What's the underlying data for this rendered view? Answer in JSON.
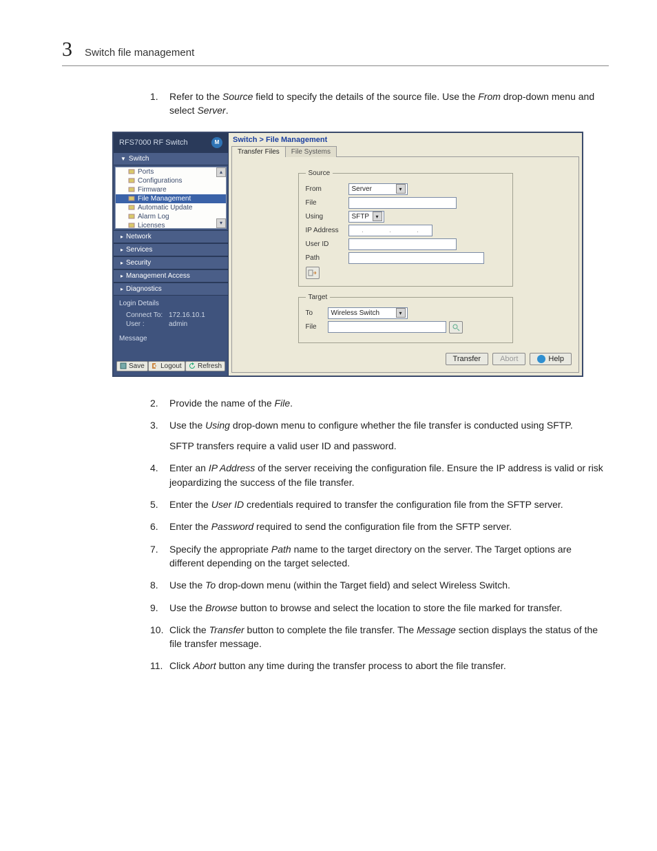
{
  "header": {
    "chapter_number": "3",
    "title": "Switch file management"
  },
  "steps_top": [
    {
      "n": "1.",
      "html": "Refer to the <i>Source</i> field to specify the details of the source file. Use the <i>From</i> drop-down menu and select <i>Server</i>."
    }
  ],
  "app": {
    "title": "RFS7000 RF Switch",
    "logo_letter": "M",
    "nav_switch": "Switch",
    "tree": [
      {
        "label": "Ports"
      },
      {
        "label": "Configurations"
      },
      {
        "label": "Firmware"
      },
      {
        "label": "File Management",
        "selected": true
      },
      {
        "label": "Automatic Update"
      },
      {
        "label": "Alarm Log"
      },
      {
        "label": "Licenses"
      }
    ],
    "sections": [
      "Network",
      "Services",
      "Security",
      "Management Access",
      "Diagnostics"
    ],
    "login": {
      "title": "Login Details",
      "connect_label": "Connect To:",
      "connect_value": "172.16.10.1",
      "user_label": "User :",
      "user_value": "admin",
      "message_label": "Message"
    },
    "bottom": {
      "save": "Save",
      "logout": "Logout",
      "refresh": "Refresh"
    }
  },
  "main": {
    "crumb": "Switch > File Management",
    "tabs": {
      "active": "Transfer Files",
      "inactive": "File Systems"
    },
    "source": {
      "legend": "Source",
      "from_label": "From",
      "from_value": "Server",
      "file_label": "File",
      "using_label": "Using",
      "using_value": "SFTP",
      "ip_label": "IP Address",
      "userid_label": "User ID",
      "path_label": "Path"
    },
    "target": {
      "legend": "Target",
      "to_label": "To",
      "to_value": "Wireless Switch",
      "file_label": "File"
    },
    "buttons": {
      "transfer": "Transfer",
      "abort": "Abort",
      "help": "Help"
    }
  },
  "steps_bottom": [
    {
      "n": "2.",
      "html": "Provide the name of the <i>File</i>."
    },
    {
      "n": "3.",
      "html": "Use the <i>Using</i> drop-down menu to configure whether the file transfer is conducted using SFTP.",
      "para": "SFTP transfers require a valid user ID and password."
    },
    {
      "n": "4.",
      "html": "Enter an <i>IP Address</i> of the server receiving the configuration file. Ensure the IP address is valid or risk jeopardizing the success of the file transfer."
    },
    {
      "n": "5.",
      "html": "Enter the <i>User ID</i> credentials required to transfer the configuration file from the SFTP server."
    },
    {
      "n": "6.",
      "html": "Enter the <i>Password</i> required to send the configuration file from the SFTP server."
    },
    {
      "n": "7.",
      "html": "Specify the appropriate <i>Path</i> name to the target directory on the server. The Target options are different depending on the target selected."
    },
    {
      "n": "8.",
      "html": "Use the <i>To</i> drop-down menu (within the Target field) and select Wireless Switch."
    },
    {
      "n": "9.",
      "html": "Use the <i>Browse</i> button to browse and select the location to store the file marked for transfer."
    },
    {
      "n": "10.",
      "html": "Click the <i>Transfer</i> button to complete the file transfer. The <i>Message</i> section displays the status of the file transfer message."
    },
    {
      "n": "11.",
      "html": "Click <i>Abort</i> button any time during the transfer process to abort the file transfer."
    }
  ]
}
